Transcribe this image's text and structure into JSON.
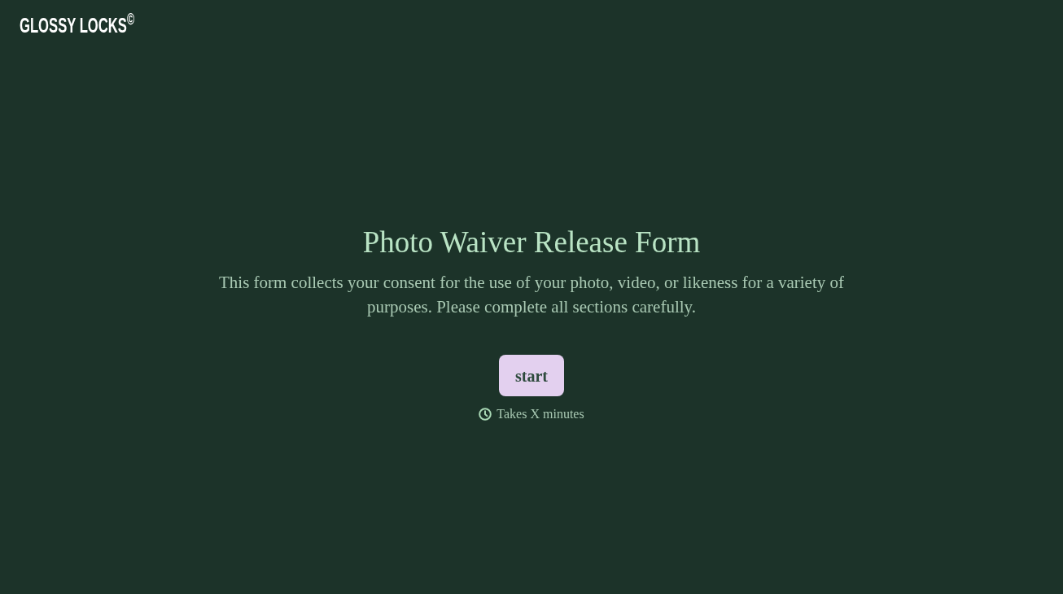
{
  "header": {
    "logo": "GLOSSY LOCKS$^{©}$"
  },
  "intro": {
    "title": "Photo Waiver Release Form",
    "description": "This form collects your consent for the use of your photo, video, or likeness for a variety of purposes. Please complete all sections carefully.",
    "start_button": "start",
    "duration": "Takes X minutes"
  }
}
